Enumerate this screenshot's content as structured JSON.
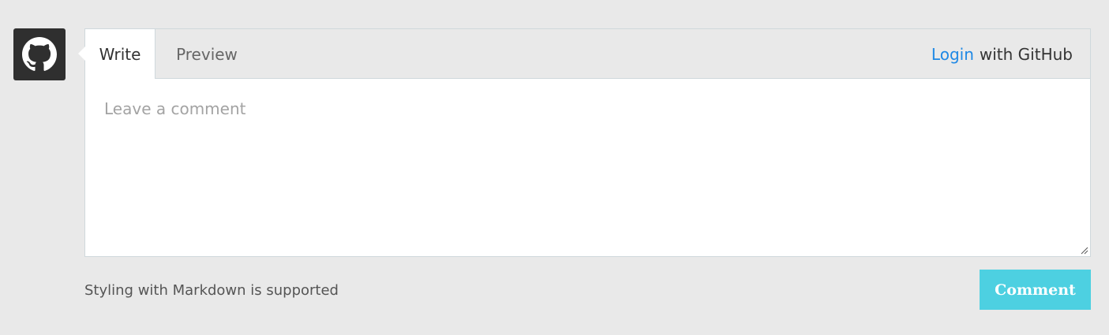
{
  "avatar": {
    "icon": "github-icon"
  },
  "tabs": [
    {
      "label": "Write",
      "active": true
    },
    {
      "label": "Preview",
      "active": false
    }
  ],
  "login": {
    "link_text": "Login",
    "suffix_text": "with GitHub"
  },
  "comment_input": {
    "placeholder": "Leave a comment",
    "value": ""
  },
  "footer": {
    "hint": "Styling with Markdown is supported",
    "comment_button_label": "Comment"
  },
  "colors": {
    "page_background": "#e9e9e9",
    "avatar_background": "#2f2f2f",
    "link": "#1e88e5",
    "button_background": "#4dd0e1"
  }
}
